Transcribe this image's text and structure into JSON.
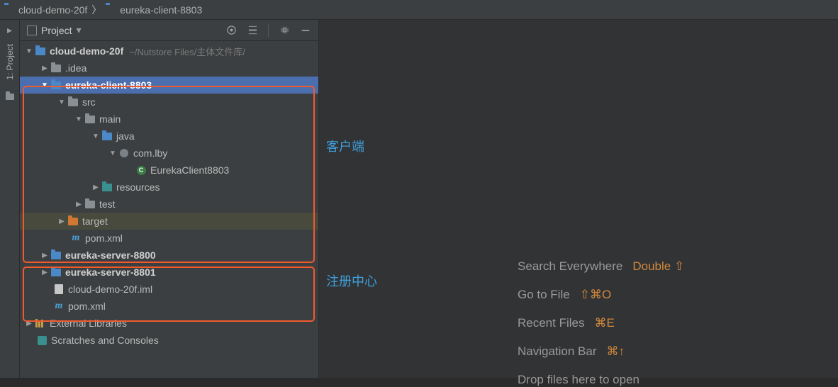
{
  "breadcrumb": {
    "root": "cloud-demo-20f",
    "current": "eureka-client-8803"
  },
  "gutter": {
    "project_label": "1: Project"
  },
  "sidebar": {
    "title": "Project",
    "root": {
      "name": "cloud-demo-20f",
      "path": "~/Nutstore Files/主体文件库/"
    },
    "items": {
      "idea": ".idea",
      "client": "eureka-client-8803",
      "src": "src",
      "main": "main",
      "java": "java",
      "pkg": "com.lby",
      "cls": "EurekaClient8803",
      "resources": "resources",
      "test": "test",
      "target": "target",
      "pom1": "pom.xml",
      "server0": "eureka-server-8800",
      "server1": "eureka-server-8801",
      "iml": "cloud-demo-20f.iml",
      "pom2": "pom.xml",
      "extlib": "External Libraries",
      "scratch": "Scratches and Consoles"
    }
  },
  "annotations": {
    "client": "客户端",
    "registry": "注册中心"
  },
  "welcome": {
    "search": "Search Everywhere",
    "search_key": "Double ⇧",
    "gotofile": "Go to File",
    "gotofile_key": "⇧⌘O",
    "recent": "Recent Files",
    "recent_key": "⌘E",
    "navbar": "Navigation Bar",
    "navbar_key": "⌘↑",
    "drop": "Drop files here to open"
  }
}
